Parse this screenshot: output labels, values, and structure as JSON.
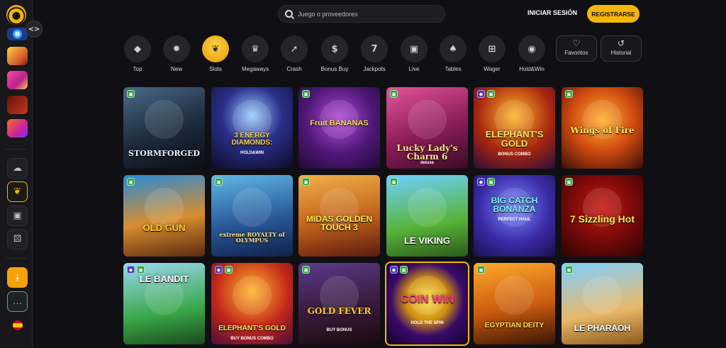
{
  "header": {
    "search_placeholder": "Juego o proveedores",
    "login_label": "INICIAR SESIÓN",
    "register_label": "REGISTRARSE"
  },
  "sidebar": {
    "collapse_icon": "<>",
    "items": [
      {
        "name": "promo-ring",
        "icon": "ring-icon"
      },
      {
        "name": "promo-crown",
        "icon": "crown-icon"
      },
      {
        "name": "promo-gift",
        "icon": "gift-icon"
      },
      {
        "name": "promo-seven",
        "icon": "seven-icon"
      },
      {
        "name": "promo-camera",
        "icon": "camera-icon"
      }
    ],
    "nav_icons": [
      "cloud-icon",
      "cherries-icon",
      "live-icon",
      "dice-icon"
    ],
    "download_icon": "download-icon",
    "chat_icon": "chat-icon",
    "language": "es"
  },
  "categories": [
    {
      "label": "Top",
      "icon": "diamond-icon",
      "glyph": "◆"
    },
    {
      "label": "New",
      "icon": "new-badge-icon",
      "glyph": "✹"
    },
    {
      "label": "Slots",
      "icon": "cherries-icon",
      "glyph": "❦",
      "active": true
    },
    {
      "label": "Megaways",
      "icon": "crown-icon",
      "glyph": "♛"
    },
    {
      "label": "Crash",
      "icon": "rocket-icon",
      "glyph": "➚"
    },
    {
      "label": "Bonus Buy",
      "icon": "money-bag-icon",
      "glyph": "$"
    },
    {
      "label": "Jackpots",
      "icon": "seven-icon",
      "glyph": "7"
    },
    {
      "label": "Live",
      "icon": "live-icon",
      "glyph": "▣"
    },
    {
      "label": "Tables",
      "icon": "cards-icon",
      "glyph": "♠"
    },
    {
      "label": "Wager",
      "icon": "gift-icon",
      "glyph": "⊞"
    },
    {
      "label": "Hold&Win",
      "icon": "hold-win-icon",
      "glyph": "◉"
    }
  ],
  "favorites_label": "Favoritos",
  "history_label": "Historial",
  "games": [
    {
      "title": "STORMFORGED",
      "sub": "",
      "badges": [
        "g"
      ]
    },
    {
      "title": "3 ENERGY DIAMONDS:",
      "sub": "HOLD&WIN",
      "badges": []
    },
    {
      "title": "Fruit BANANAS",
      "sub": "",
      "badges": [
        "g"
      ]
    },
    {
      "title": "Lucky Lady's Charm 6",
      "sub": "deluxe",
      "badges": [
        "g"
      ]
    },
    {
      "title": "ELEPHANT'S GOLD",
      "sub": "BONUS COMBO",
      "badges": [
        "p",
        "g"
      ]
    },
    {
      "title": "Wings of Fire",
      "sub": "",
      "badges": [
        "g"
      ]
    },
    {
      "title": "OLD GUN",
      "sub": "",
      "badges": [
        "g"
      ]
    },
    {
      "title": "extreme ROYALTY of OLYMPUS",
      "sub": "",
      "badges": [
        "g"
      ]
    },
    {
      "title": "MIDAS GOLDEN TOUCH 3",
      "sub": "",
      "badges": [
        "g"
      ]
    },
    {
      "title": "LE VIKING",
      "sub": "",
      "badges": [
        "g"
      ]
    },
    {
      "title": "BIG CATCH BONANZA",
      "sub": "PERFECT HAUL",
      "badges": [
        "p",
        "g"
      ]
    },
    {
      "title": "7 Sizzling Hot",
      "sub": "",
      "badges": [
        "g"
      ]
    },
    {
      "title": "LE BANDIT",
      "sub": "",
      "badges": [
        "p",
        "g"
      ]
    },
    {
      "title": "ELEPHANT'S GOLD",
      "sub": "BUY BONUS COMBO",
      "badges": [
        "p",
        "g"
      ]
    },
    {
      "title": "GOLD FEVER",
      "sub": "BUY BONUS",
      "badges": [
        "g"
      ]
    },
    {
      "title": "COIN WIN",
      "sub": "HOLD THE SPIN",
      "badges": [
        "p",
        "g"
      ]
    },
    {
      "title": "EGYPTIAN DEITY",
      "sub": "",
      "badges": [
        "g"
      ]
    },
    {
      "title": "LE PHARAOH",
      "sub": "",
      "badges": [
        "g"
      ]
    }
  ]
}
